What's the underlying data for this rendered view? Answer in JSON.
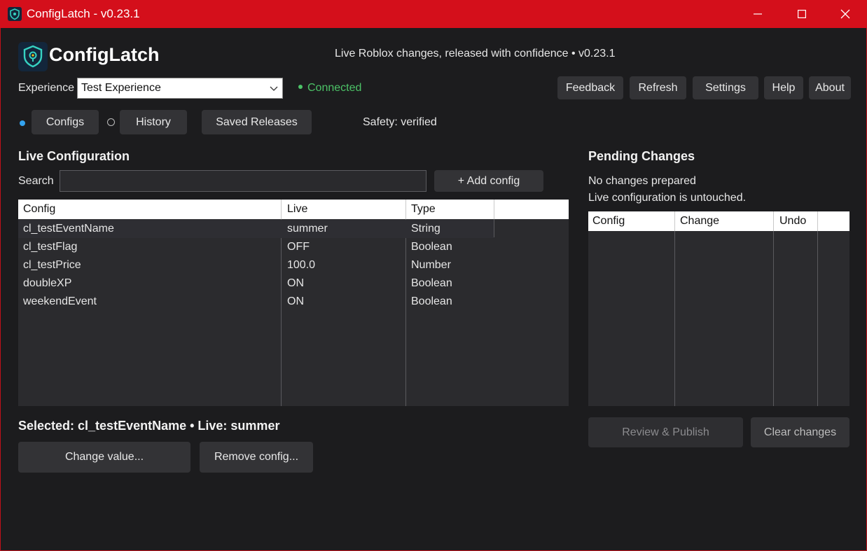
{
  "window": {
    "title": "ConfigLatch - v0.23.1",
    "controls": [
      "minimize-icon",
      "maximize-icon",
      "close-icon"
    ]
  },
  "header": {
    "brand": "ConfigLatch",
    "tagline": "Live Roblox changes, released with confidence  •  v0.23.1"
  },
  "experience": {
    "label": "Experience",
    "selected": "Test Experience",
    "status": "Connected"
  },
  "toolbar": {
    "feedback": "Feedback",
    "refresh": "Refresh",
    "settings": "Settings",
    "help": "Help",
    "about": "About"
  },
  "tabs": {
    "configs": "Configs",
    "history": "History",
    "saved_releases": "Saved Releases",
    "active": "Configs"
  },
  "safety": "Safety: verified",
  "live": {
    "title": "Live Configuration",
    "search_label": "Search",
    "search_value": "",
    "add_button": "+ Add config",
    "columns": [
      "Config",
      "Live",
      "Type"
    ],
    "rows": [
      {
        "config": "cl_testEventName",
        "live": "summer",
        "type": "String"
      },
      {
        "config": "cl_testFlag",
        "live": "OFF",
        "type": "Boolean"
      },
      {
        "config": "cl_testPrice",
        "live": "100.0",
        "type": "Number"
      },
      {
        "config": "doubleXP",
        "live": "ON",
        "type": "Boolean"
      },
      {
        "config": "weekendEvent",
        "live": "ON",
        "type": "Boolean"
      }
    ],
    "selected_text": "Selected: cl_testEventName  •  Live: summer",
    "change_value": "Change value...",
    "remove_config": "Remove config..."
  },
  "pending": {
    "title": "Pending Changes",
    "line1": "No changes prepared",
    "line2": "Live configuration is untouched.",
    "columns": [
      "Config",
      "Change",
      "Undo"
    ],
    "review_publish": "Review & Publish",
    "clear_changes": "Clear changes"
  },
  "colors": {
    "titlebar": "#d40f1b",
    "connected": "#4cc267",
    "radio_active": "#33a3f0",
    "background": "#1c1c1e"
  }
}
